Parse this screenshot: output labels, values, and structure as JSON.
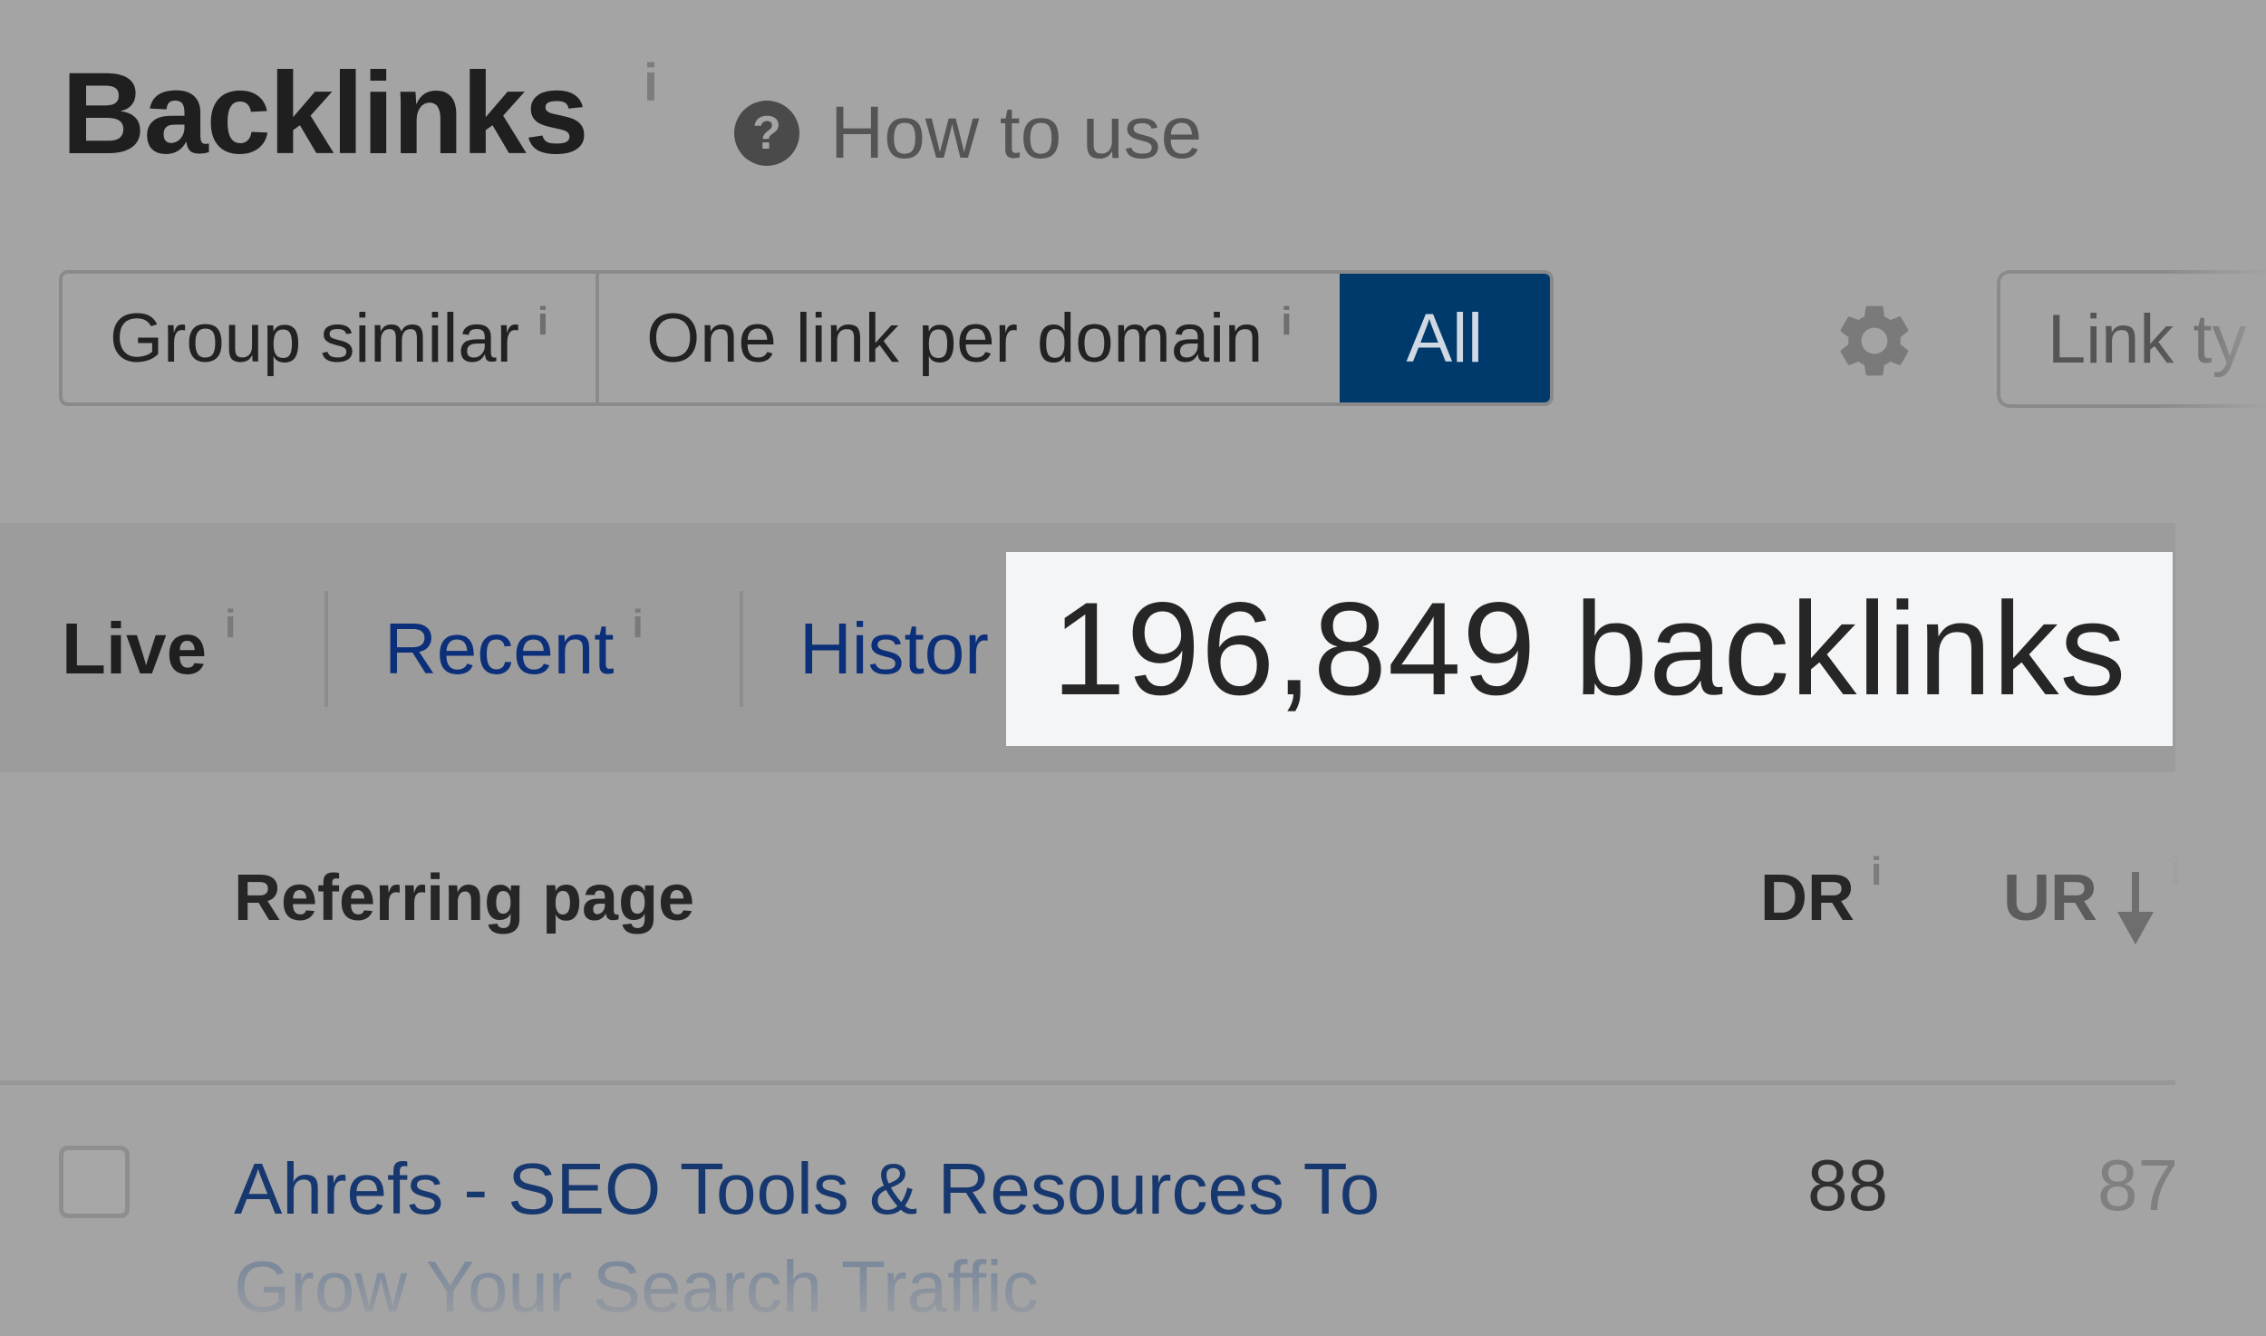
{
  "header": {
    "title": "Backlinks",
    "title_info": "i",
    "how_to_use": "How to use",
    "help_icon_glyph": "?"
  },
  "toolbar": {
    "segments": [
      {
        "label": "Group similar",
        "info": "i",
        "active": false
      },
      {
        "label": "One link per domain",
        "info": "i",
        "active": false
      },
      {
        "label": "All",
        "info": "",
        "active": true
      }
    ],
    "settings_icon": "gear-icon",
    "link_type_label": "Link ty",
    "active_color": "#003a6c"
  },
  "tabs": [
    {
      "label": "Live",
      "info": "i",
      "active": true
    },
    {
      "label": "Recent",
      "info": "i",
      "active": false
    },
    {
      "label": "Histor",
      "info": "",
      "active": false
    }
  ],
  "summary": {
    "count_text": "196,849 backlinks"
  },
  "table": {
    "columns": [
      {
        "label": "Referring page",
        "info": ""
      },
      {
        "label": "DR",
        "info": "i"
      },
      {
        "label": "UR",
        "info": "i",
        "sort": "desc"
      }
    ],
    "rows": [
      {
        "title_line1": "Ahrefs - SEO Tools & Resources To",
        "title_line2": "Grow Your Search Traffic",
        "dr": "88",
        "ur": "87",
        "checked": false
      }
    ]
  }
}
